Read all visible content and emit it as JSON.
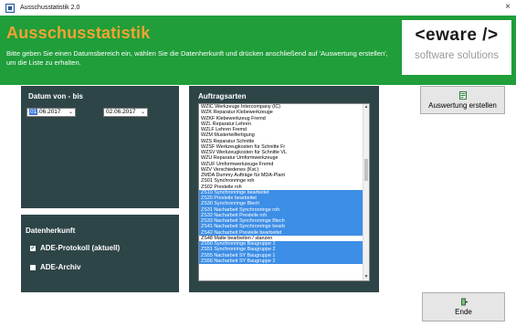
{
  "window": {
    "title": "Ausschusstatistik 2.0",
    "close_glyph": "×"
  },
  "header": {
    "app_title": "Ausschusstatistik",
    "instruction": "Bitte geben Sie einen Datumsbereich ein, wählen Sie die Datenherkunft und drücken anschließend auf 'Auswertung erstellen', um die Liste zu erhalten.",
    "bg_color": "#1f9e3a",
    "title_color": "#f3a233"
  },
  "logo": {
    "top": "<eware />",
    "bottom": "software solutions"
  },
  "date_panel": {
    "title": "Datum von - bis",
    "from": {
      "day": "01",
      "rest": ".06.2017"
    },
    "to": "02.06.2017",
    "dropdown_glyph": "⌄"
  },
  "source_panel": {
    "title": "Datenherkunft",
    "options": [
      {
        "label": "ADE-Protokoll (aktuell)",
        "checked": true,
        "mark": "✓"
      },
      {
        "label": "ADE-Archiv",
        "checked": false,
        "mark": ""
      }
    ]
  },
  "orders_panel": {
    "title": "Auftragsarten",
    "items": [
      {
        "label": "WZIC Werkzeuge Intercompany (IC)",
        "selected": false
      },
      {
        "label": "WZK  Reparatur Klebewerkzeuge",
        "selected": false
      },
      {
        "label": "WZKF Klebewerkzeug Fremd",
        "selected": false
      },
      {
        "label": "WZL  Reparatur Lehren",
        "selected": false
      },
      {
        "label": "WZLF Lehren Fremd",
        "selected": false
      },
      {
        "label": "WZM  Musterteilfertigung",
        "selected": false
      },
      {
        "label": "WZS  Reparatur Schnitte",
        "selected": false
      },
      {
        "label": "WZSF Werkzeugkosten für Schnitte Fr",
        "selected": false
      },
      {
        "label": "WZSV Werkzeugkosten für Schnitte VL",
        "selected": false
      },
      {
        "label": "WZU  Reparatur Umformwerkzeuge",
        "selected": false
      },
      {
        "label": "WZUF Umformwerkzeuge Fremd",
        "selected": false
      },
      {
        "label": "WZV  Verschiedenes (Kst.)",
        "selected": false
      },
      {
        "label": "ZMDA Dummy Aufträge für MDA-Plant",
        "selected": false
      },
      {
        "label": "ZS01 Synchronringe roh",
        "selected": false
      },
      {
        "label": "ZS02 Presteile roh",
        "selected": false
      },
      {
        "label": "ZS10 Synchronringe bearbeitet",
        "selected": true
      },
      {
        "label": "ZS20 Presteile bearbeitet",
        "selected": true
      },
      {
        "label": "ZS30 Synchronringe Blech",
        "selected": true
      },
      {
        "label": "ZS31 Nacharbeit Synchronringe roh",
        "selected": true
      },
      {
        "label": "ZS32 Nacharbeit Presteile roh",
        "selected": true
      },
      {
        "label": "ZS33 Nacharbeit Synchronringe Blech",
        "selected": true
      },
      {
        "label": "ZS41 Nacharbeit Synchronringe bearb",
        "selected": true
      },
      {
        "label": "ZS42 Nacharbeit Presteile bearbeitet",
        "selected": true
      },
      {
        "label": "ZS48 Matte bearbeiten / stanzen",
        "selected": false
      },
      {
        "label": "ZS50 Synchronringe Baugruppe 1",
        "selected": true
      },
      {
        "label": "ZS51 Synchronringe Baugruppe 2",
        "selected": true
      },
      {
        "label": "ZS55 Nacharbeit SY Baugruppe 1",
        "selected": true
      },
      {
        "label": "ZS56 Nacharbeit SY Baugruppe 2",
        "selected": true
      }
    ],
    "scroll_up_glyph": "▲",
    "scroll_down_glyph": "▼"
  },
  "buttons": {
    "create": "Auswertung erstellen",
    "end": "Ende"
  }
}
